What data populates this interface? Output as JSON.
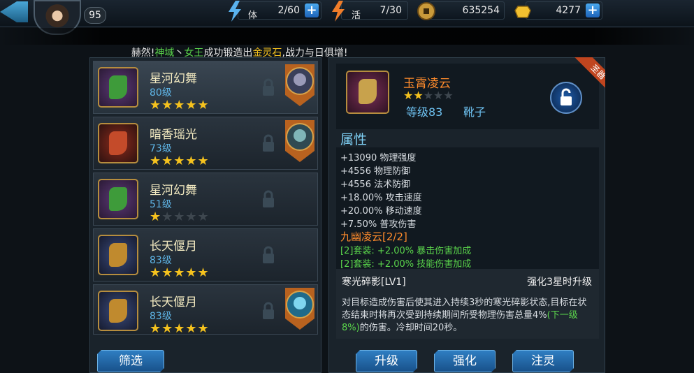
{
  "topbar": {
    "level": "95",
    "stamina": {
      "label": "体",
      "value": "2/60"
    },
    "vitality": {
      "label": "活",
      "value": "7/30"
    },
    "coins": {
      "value": "635254"
    },
    "ingots": {
      "value": "4277"
    },
    "plus": "+"
  },
  "ticker": {
    "part1": "赫然!",
    "part2": "神域",
    "part3": "丶",
    "part4": "女王",
    "part5": "成功锻造出",
    "part6": "金灵石",
    "part7": ",战力与日俱增!"
  },
  "equip_list": [
    {
      "name": "星河幻舞",
      "level": "80级",
      "stars": "★★★★★",
      "stars_off": ""
    },
    {
      "name": "暗香瑶光",
      "level": "73级",
      "stars": "★★★★★",
      "stars_off": ""
    },
    {
      "name": "星河幻舞",
      "level": "51级",
      "stars": "★",
      "stars_off": "★★★★"
    },
    {
      "name": "长天偃月",
      "level": "83级",
      "stars": "★★★★★",
      "stars_off": ""
    },
    {
      "name": "长天偃月",
      "level": "83级",
      "stars": "★★★★★",
      "stars_off": ""
    }
  ],
  "filter_button": "筛选",
  "detail": {
    "ribbon": "圣器",
    "name": "玉霄凌云",
    "stars_on": "★★",
    "stars_off": "★★★",
    "level": "等级83",
    "type": "靴子",
    "attr_title": "属性",
    "attrs": [
      "+13090 物理强度",
      "+4556 物理防御",
      "+4556 法术防御",
      "+18.00% 攻击速度",
      "+20.00% 移动速度",
      "+7.50% 普攻伤害"
    ],
    "set_name": "九幽凌云[2/2]",
    "set_bonus": [
      "[2]套装: +2.00% 暴击伤害加成",
      "[2]套装: +2.00% 技能伤害加成"
    ],
    "skill_name": "寒光碎影[LV1]",
    "skill_note": "强化3星时升级",
    "skill_desc_1": "对目标造成伤害后使其进入持续3秒的寒光碎影状态,目标在状态结束时将再次受到持续期间所受物理伤害总量4%",
    "skill_desc_green": "(下一级8%)",
    "skill_desc_2": "的伤害。冷却时间20秒。"
  },
  "buttons": {
    "upgrade": "升级",
    "enhance": "强化",
    "infuse": "注灵"
  },
  "colors": {
    "accent_blue": "#2f7ec2",
    "gold": "#f5c21e",
    "orange_name": "#ff8b2b",
    "green_bonus": "#5ad44b"
  }
}
